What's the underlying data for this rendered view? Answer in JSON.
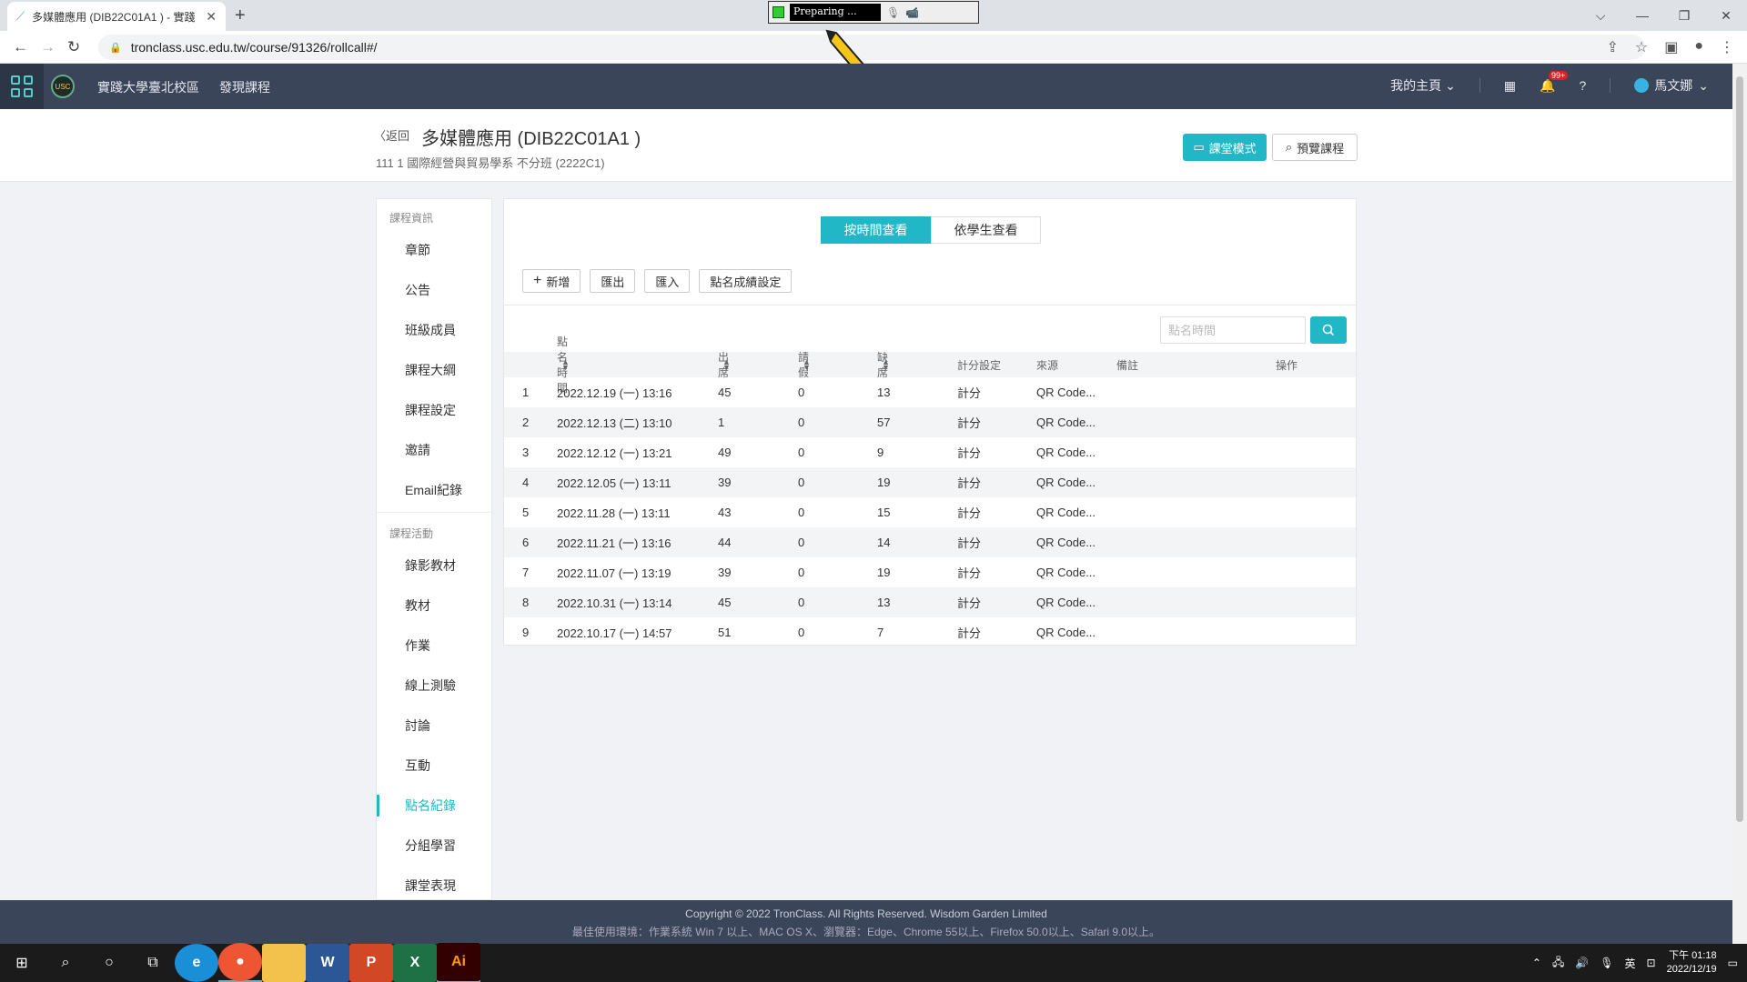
{
  "browser": {
    "tab_title": "多媒體應用 (DIB22C01A1 ) - 實踐",
    "url": "tronclass.usc.edu.tw/course/91326/rollcall#/",
    "recorder_label": "Preparing ..."
  },
  "header": {
    "nav": [
      "實踐大學臺北校區",
      "發現課程"
    ],
    "home_label": "我的主頁",
    "badge": "99+",
    "user_name": "馬文娜"
  },
  "course": {
    "back_label": "返回",
    "title": "多媒體應用 (DIB22C01A1 )",
    "subtitle": "111 1 國際經營與貿易學系 不分班 (2222C1)",
    "classroom_mode_label": "課堂模式",
    "preview_label": "預覽課程"
  },
  "sidebar": {
    "section1": "課程資訊",
    "items1": [
      "章節",
      "公告",
      "班級成員",
      "課程大綱",
      "課程設定",
      "邀請",
      "Email紀錄"
    ],
    "section2": "課程活動",
    "items2": [
      "錄影教材",
      "教材",
      "作業",
      "線上測驗",
      "討論",
      "互動",
      "點名紀錄",
      "分組學習",
      "課堂表現"
    ],
    "active": "點名紀錄"
  },
  "view_toggle": {
    "by_time": "按時間查看",
    "by_student": "依學生查看"
  },
  "actions": {
    "add": "新增",
    "export": "匯出",
    "import": "匯入",
    "score_settings": "點名成績設定"
  },
  "search": {
    "placeholder": "點名時間"
  },
  "table": {
    "headers": {
      "time": "點名時間",
      "attend": "出席",
      "leave": "請假",
      "absent": "缺席",
      "score": "計分設定",
      "source": "來源",
      "note": "備註",
      "op": "操作"
    },
    "rows": [
      {
        "idx": "1",
        "time": "2022.12.19 (一) 13:16",
        "attend": "45",
        "leave": "0",
        "absent": "13",
        "score": "計分",
        "source": "QR Code..."
      },
      {
        "idx": "2",
        "time": "2022.12.13 (二) 13:10",
        "attend": "1",
        "leave": "0",
        "absent": "57",
        "score": "計分",
        "source": "QR Code..."
      },
      {
        "idx": "3",
        "time": "2022.12.12 (一) 13:21",
        "attend": "49",
        "leave": "0",
        "absent": "9",
        "score": "計分",
        "source": "QR Code..."
      },
      {
        "idx": "4",
        "time": "2022.12.05 (一) 13:11",
        "attend": "39",
        "leave": "0",
        "absent": "19",
        "score": "計分",
        "source": "QR Code..."
      },
      {
        "idx": "5",
        "time": "2022.11.28 (一) 13:11",
        "attend": "43",
        "leave": "0",
        "absent": "15",
        "score": "計分",
        "source": "QR Code..."
      },
      {
        "idx": "6",
        "time": "2022.11.21 (一) 13:16",
        "attend": "44",
        "leave": "0",
        "absent": "14",
        "score": "計分",
        "source": "QR Code..."
      },
      {
        "idx": "7",
        "time": "2022.11.07 (一) 13:19",
        "attend": "39",
        "leave": "0",
        "absent": "19",
        "score": "計分",
        "source": "QR Code..."
      },
      {
        "idx": "8",
        "time": "2022.10.31 (一) 13:14",
        "attend": "45",
        "leave": "0",
        "absent": "13",
        "score": "計分",
        "source": "QR Code..."
      },
      {
        "idx": "9",
        "time": "2022.10.17 (一) 14:57",
        "attend": "51",
        "leave": "0",
        "absent": "7",
        "score": "計分",
        "source": "QR Code..."
      }
    ]
  },
  "footer": {
    "copyright": "Copyright © 2022 TronClass. All Rights Reserved. Wisdom Garden Limited",
    "env": "最佳使用環境：作業系統 Win 7 以上、MAC OS X、瀏覽器：Edge、Chrome 55以上、Firefox 50.0以上、Safari 9.0以上。"
  },
  "taskbar": {
    "ime": "英",
    "time": "下午 01:18",
    "date": "2022/12/19",
    "apps": [
      "W",
      "P",
      "X",
      "Ai"
    ]
  },
  "colors": {
    "accent": "#22b7c7",
    "header_bg": "#3a4559"
  }
}
